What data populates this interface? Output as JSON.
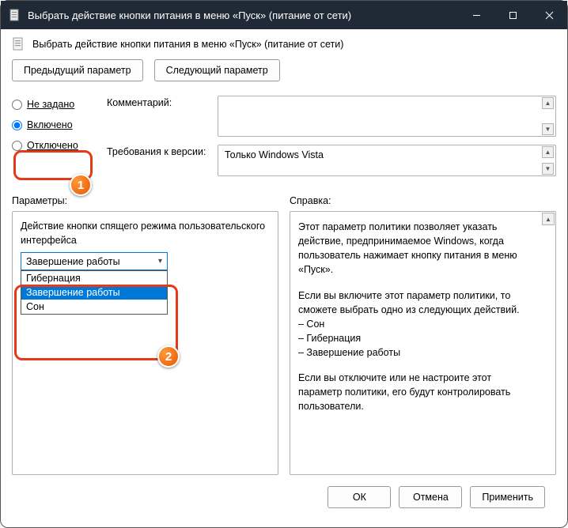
{
  "window": {
    "title": "Выбрать действие кнопки питания в меню «Пуск» (питание от сети)"
  },
  "header": {
    "subtitle": "Выбрать действие кнопки питания в меню «Пуск» (питание от сети)"
  },
  "nav": {
    "prev": "Предыдущий параметр",
    "next": "Следующий параметр"
  },
  "radios": {
    "not_configured": "Не задано",
    "enabled": "Включено",
    "disabled": "Отключено"
  },
  "meta": {
    "comment_label": "Комментарий:",
    "comment_value": "",
    "requirements_label": "Требования к версии:",
    "requirements_value": "Только Windows Vista"
  },
  "columns": {
    "options_label": "Параметры:",
    "help_label": "Справка:"
  },
  "options": {
    "description": "Действие кнопки спящего режима пользовательского интерфейса",
    "selected": "Завершение работы",
    "list": {
      "hibernate": "Гибернация",
      "shutdown": "Завершение работы",
      "sleep": "Сон"
    }
  },
  "help": {
    "p1": "Этот параметр политики позволяет указать действие, предпринимаемое Windows, когда пользователь нажимает кнопку питания в меню «Пуск».",
    "p2": "Если вы включите этот параметр политики, то сможете выбрать одно из следующих действий.",
    "l1": "– Сон",
    "l2": "– Гибернация",
    "l3": "– Завершение работы",
    "p3": "Если вы отключите или не настроите этот параметр политики, его будут контролировать пользователи."
  },
  "footer": {
    "ok": "ОК",
    "cancel": "Отмена",
    "apply": "Применить"
  },
  "annotations": {
    "b1": "1",
    "b2": "2"
  }
}
